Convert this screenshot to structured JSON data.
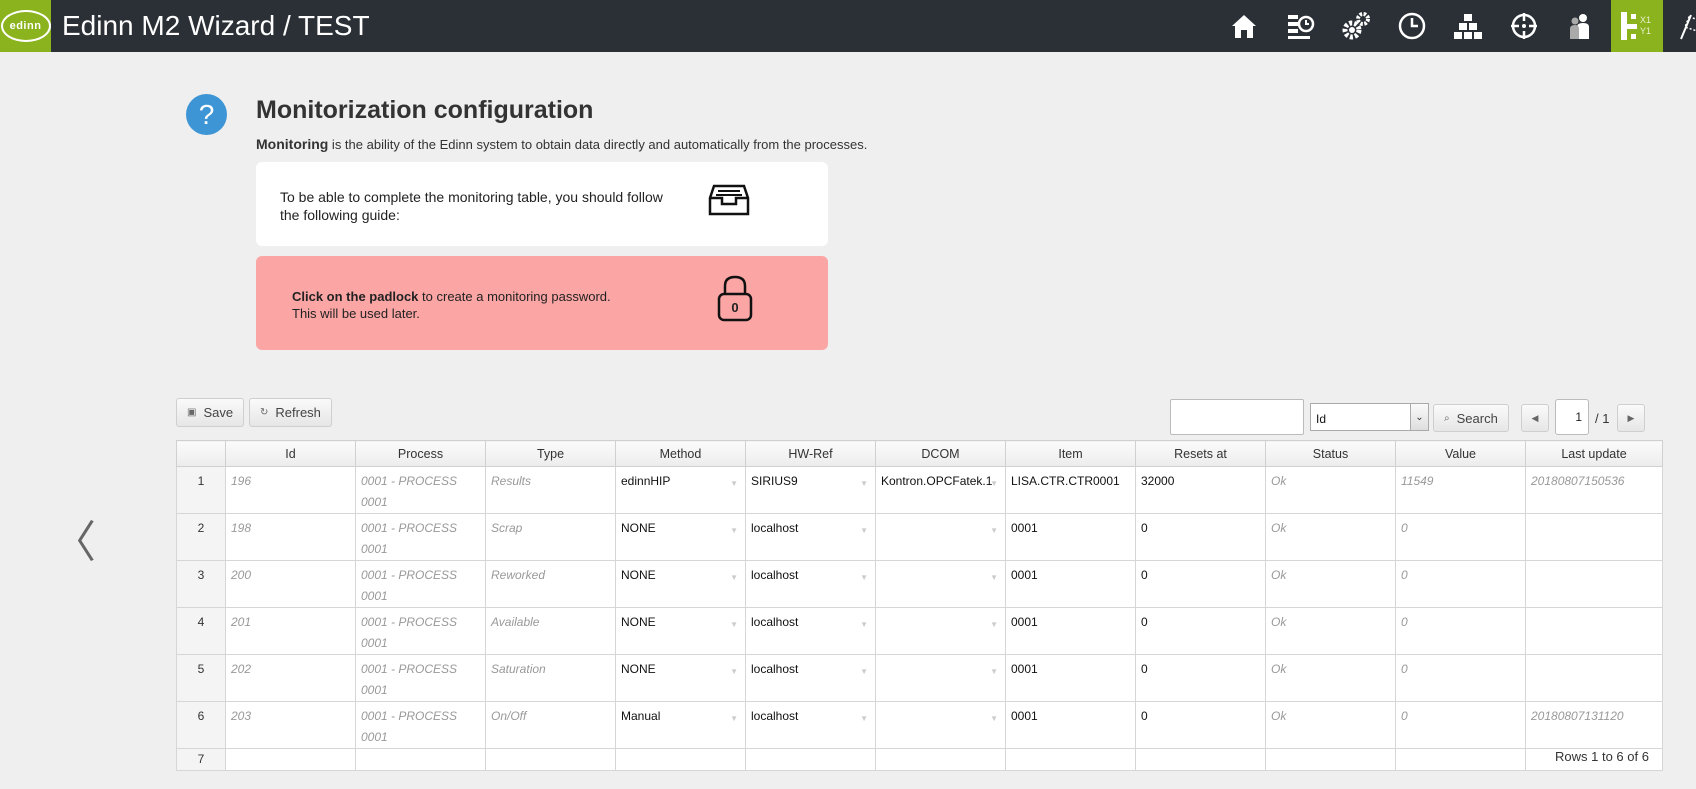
{
  "app": {
    "title": "Edinn M2 Wizard / TEST",
    "logo_text": "edinn"
  },
  "nav_icons": [
    "home-icon",
    "schedule-icon",
    "settings-gears-icon",
    "clock-icon",
    "hierarchy-icon",
    "target-icon",
    "users-icon",
    "xy-coordinates-icon",
    "finish-flag-icon"
  ],
  "help": {
    "icon_text": "?",
    "title": "Monitorization configuration",
    "subtitle_bold": "Monitoring",
    "subtitle_rest": " is the ability of the Edinn system to obtain data directly and automatically from the processes."
  },
  "guide_card": {
    "text": "To be able to complete the monitoring table, you should follow the following guide:"
  },
  "padlock_card": {
    "bold": "Click on the padlock",
    "rest": " to create a monitoring password.",
    "line2": "This will be used later.",
    "padlock_value": "0"
  },
  "toolbar": {
    "save_label": "Save",
    "refresh_label": "Refresh",
    "search_value": "",
    "search_field_selected": "Id",
    "search_button_label": "Search",
    "page_current": "1",
    "page_total": "/ 1",
    "prev_symbol": "◀",
    "next_symbol": "▶",
    "select_arrow": "⌄"
  },
  "table": {
    "columns": [
      "Id",
      "Process",
      "Type",
      "Method",
      "HW-Ref",
      "DCOM",
      "Item",
      "Resets at",
      "Status",
      "Value",
      "Last update"
    ],
    "rows": [
      {
        "n": "1",
        "id": "196",
        "process": "0001 - PROCESS 0001",
        "type": "Results",
        "method": "edinnHIP",
        "hwref": "SIRIUS9",
        "dcom": "Kontron.OPCFatek.1",
        "item": "LISA.CTR.CTR0001",
        "resets": "32000",
        "status": "Ok",
        "value": "11549",
        "updated": "20180807150536"
      },
      {
        "n": "2",
        "id": "198",
        "process": "0001 - PROCESS 0001",
        "type": "Scrap",
        "method": "NONE",
        "hwref": "localhost",
        "dcom": "",
        "item": "0001",
        "resets": "0",
        "status": "Ok",
        "value": "0",
        "updated": ""
      },
      {
        "n": "3",
        "id": "200",
        "process": "0001 - PROCESS 0001",
        "type": "Reworked",
        "method": "NONE",
        "hwref": "localhost",
        "dcom": "",
        "item": "0001",
        "resets": "0",
        "status": "Ok",
        "value": "0",
        "updated": ""
      },
      {
        "n": "4",
        "id": "201",
        "process": "0001 - PROCESS 0001",
        "type": "Available",
        "method": "NONE",
        "hwref": "localhost",
        "dcom": "",
        "item": "0001",
        "resets": "0",
        "status": "Ok",
        "value": "0",
        "updated": ""
      },
      {
        "n": "5",
        "id": "202",
        "process": "0001 - PROCESS 0001",
        "type": "Saturation",
        "method": "NONE",
        "hwref": "localhost",
        "dcom": "",
        "item": "0001",
        "resets": "0",
        "status": "Ok",
        "value": "0",
        "updated": ""
      },
      {
        "n": "6",
        "id": "203",
        "process": "0001 - PROCESS 0001",
        "type": "On/Off",
        "method": "Manual",
        "hwref": "localhost",
        "dcom": "",
        "item": "0001",
        "resets": "0",
        "status": "Ok",
        "value": "0",
        "updated": "20180807131120"
      }
    ],
    "empty_row_number": "7",
    "rows_info": "Rows 1 to 6 of 6"
  },
  "colors": {
    "topbar": "#2b3036",
    "accent_green": "#8bb31d",
    "help_blue": "#3e95d5",
    "alert_pink": "#fca5a5"
  }
}
